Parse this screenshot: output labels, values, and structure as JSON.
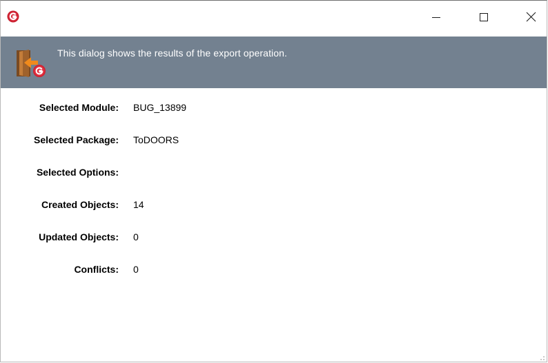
{
  "window": {
    "app_icon": "g-logo-icon",
    "controls": {
      "minimize": "minimize-icon",
      "maximize": "maximize-icon",
      "close": "close-icon"
    }
  },
  "banner": {
    "icon": "export-door-icon",
    "text": "This dialog shows the results of the export operation.",
    "background": "#738190"
  },
  "results": {
    "selected_module": {
      "label": "Selected Module:",
      "value": "BUG_13899"
    },
    "selected_package": {
      "label": "Selected Package:",
      "value": "ToDOORS"
    },
    "selected_options": {
      "label": "Selected Options:",
      "value": ""
    },
    "created_objects": {
      "label": "Created Objects:",
      "value": "14"
    },
    "updated_objects": {
      "label": "Updated Objects:",
      "value": "0"
    },
    "conflicts": {
      "label": "Conflicts:",
      "value": "0"
    }
  }
}
